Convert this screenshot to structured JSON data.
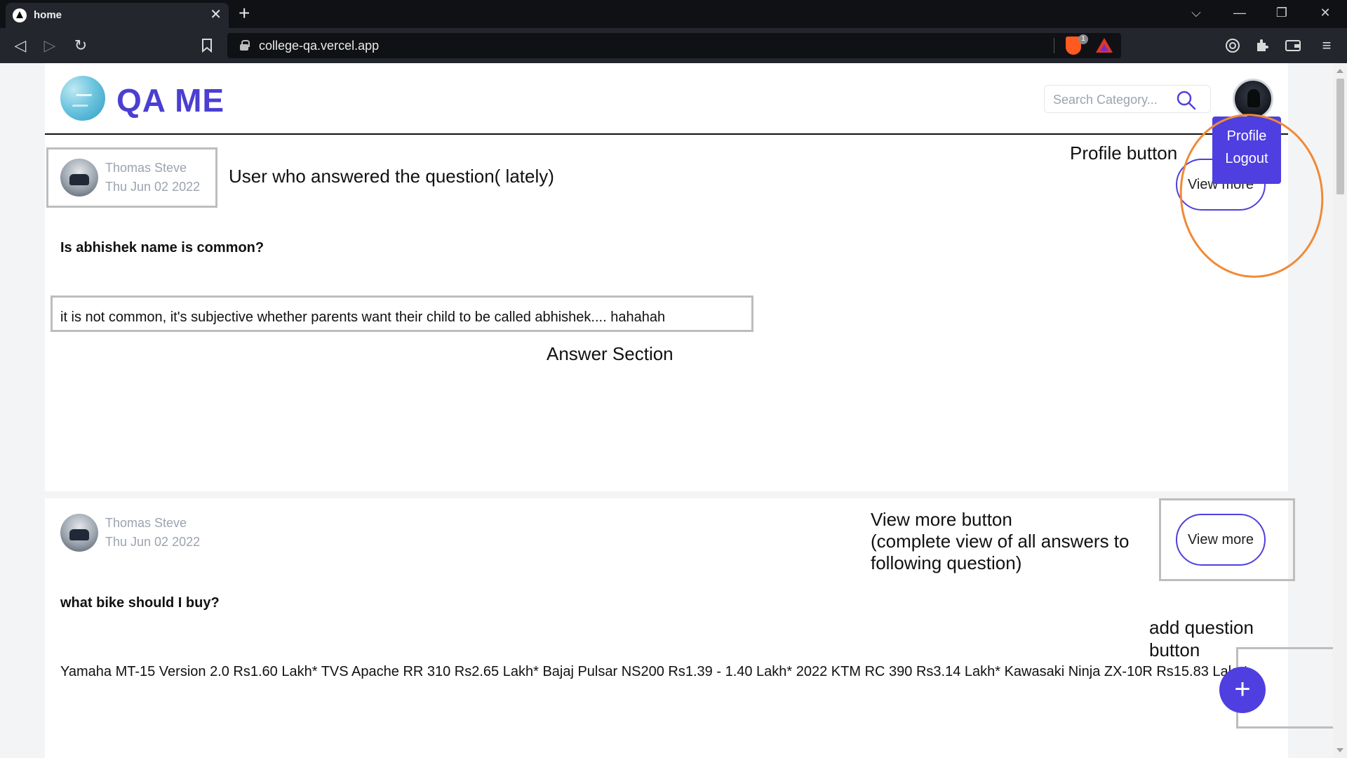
{
  "browser": {
    "tab_title": "home",
    "tab_close": "✕",
    "new_tab": "+",
    "url": "college-qa.vercel.app",
    "shield_badge": "1",
    "window_controls": {
      "dropdown": "⌵",
      "minimize": "—",
      "restore": "❐",
      "close": "✕"
    }
  },
  "header": {
    "brand": "QA ME",
    "search_placeholder": "Search Category...",
    "dropdown": {
      "profile": "Profile",
      "logout": "Logout"
    }
  },
  "posts": [
    {
      "user_name": "Thomas Steve",
      "date": "Thu Jun 02 2022",
      "question": "Is abhishek name is common?",
      "answer": "it is not common, it's subjective whether parents want their child to be called abhishek.... hahahah",
      "view_more_label": "View more"
    },
    {
      "user_name": "Thomas Steve",
      "date": "Thu Jun 02 2022",
      "question": "what bike should I buy?",
      "answer": "Yamaha MT-15 Version 2.0 Rs1.60 Lakh* TVS Apache RR 310 Rs2.65 Lakh* Bajaj Pulsar NS200 Rs1.39 - 1.40 Lakh* 2022 KTM RC 390 Rs3.14 Lakh* Kawasaki Ninja ZX-10R Rs15.83 Lakh*",
      "view_more_label": "View more"
    }
  ],
  "annotations": {
    "user_answered": "User who answered the question( lately)",
    "profile_button": "Profile button",
    "answer_section": "Answer Section",
    "view_more_line1": "View more button",
    "view_more_line2": "(complete view of all answers to",
    "view_more_line3": "following question)",
    "add_question": "add question button"
  },
  "fab_label": "+",
  "colors": {
    "accent": "#4f3fe0",
    "annotation_circle": "#f08a36"
  }
}
